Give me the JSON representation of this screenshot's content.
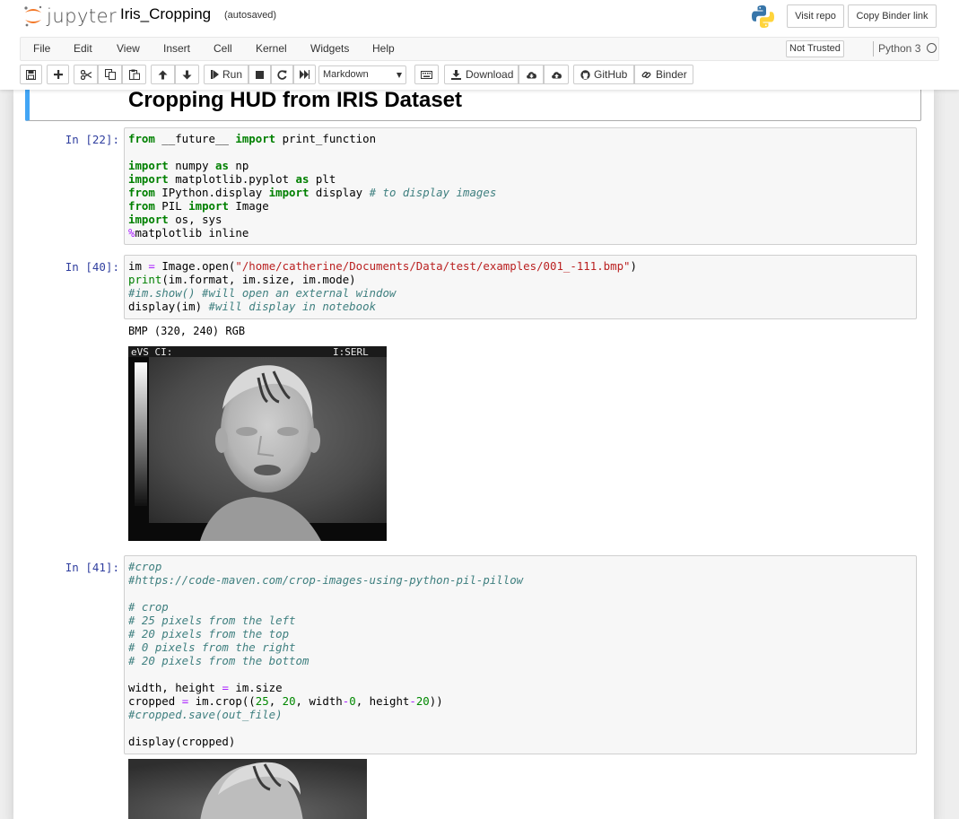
{
  "header": {
    "logo_text": "jupyter",
    "notebook_name": "Iris_Cropping",
    "autosave": "(autosaved)",
    "visit_repo": "Visit repo",
    "copy_binder": "Copy Binder link"
  },
  "menu": {
    "items": [
      "File",
      "Edit",
      "View",
      "Insert",
      "Cell",
      "Kernel",
      "Widgets",
      "Help"
    ],
    "trust": "Not Trusted",
    "kernel": "Python 3"
  },
  "toolbar": {
    "run": "Run",
    "cell_type": "Markdown",
    "download": "Download",
    "github": "GitHub",
    "binder": "Binder"
  },
  "notebook": {
    "heading": "Cropping HUD from IRIS Dataset",
    "cells": [
      {
        "prompt": "In [22]:"
      },
      {
        "prompt": "In [40]:",
        "output": "BMP (320, 240) RGB"
      },
      {
        "prompt": "In [41]:"
      }
    ],
    "image_overlay": {
      "left": "eVS CI:",
      "right": "I:SERL"
    }
  },
  "colors": {
    "accent": "#42a5f5",
    "prompt": "#303f9f",
    "keyword": "#008000",
    "comment": "#408080",
    "string": "#ba2121",
    "operator": "#aa22ff"
  }
}
